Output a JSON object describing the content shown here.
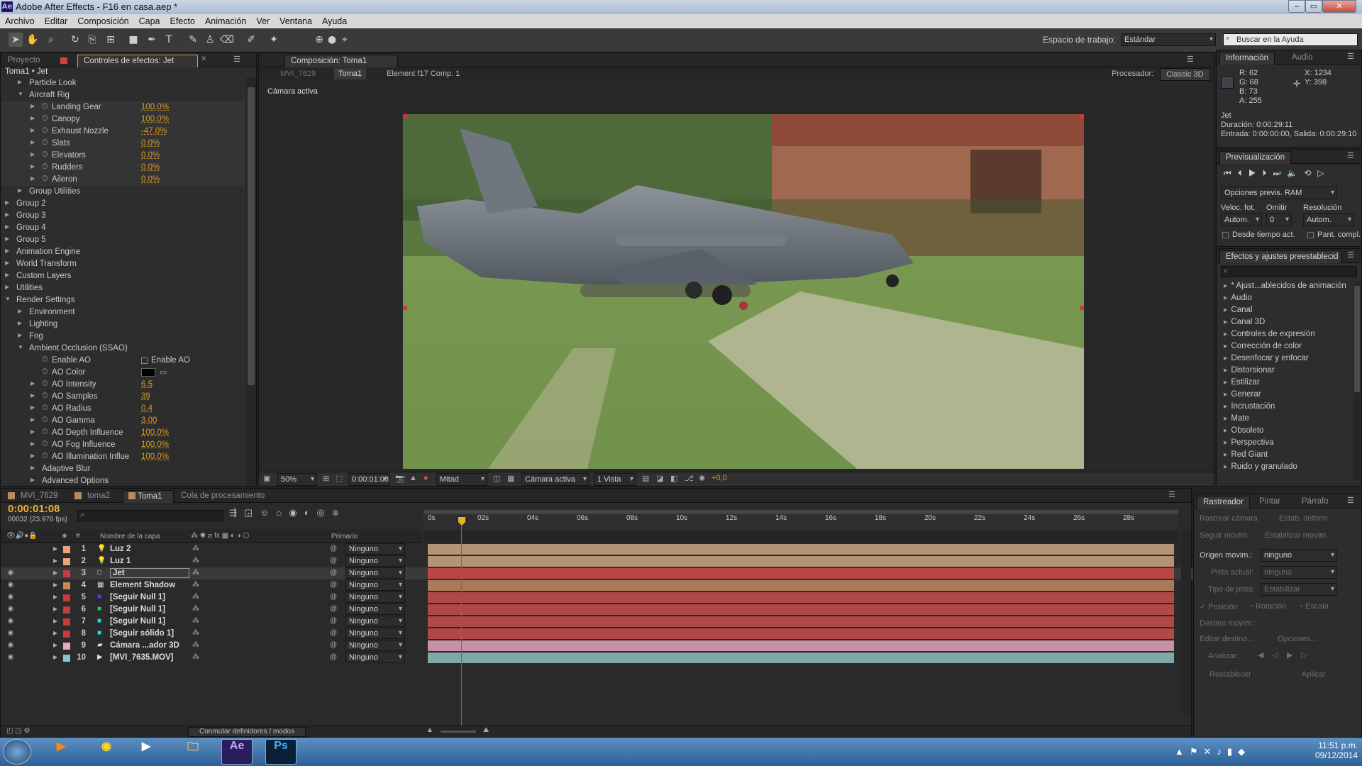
{
  "window": {
    "title": "Adobe After Effects - F16 en casa.aep *"
  },
  "menu": [
    "Archivo",
    "Editar",
    "Composición",
    "Capa",
    "Efecto",
    "Animación",
    "Ver",
    "Ventana",
    "Ayuda"
  ],
  "toolbar": {
    "workspace_label": "Espacio de trabajo:",
    "workspace_value": "Estándar",
    "search_placeholder": "Buscar en la Ayuda"
  },
  "left_panel": {
    "tab_project": "Proyecto",
    "tab_effects": "Controles de efectos: Jet",
    "breadcrumb": "Toma1 • Jet",
    "rows": [
      {
        "label": "Particle Look",
        "indent": 2,
        "tri": "closed"
      },
      {
        "label": "Aircraft Rig",
        "indent": 2,
        "tri": "open"
      },
      {
        "label": "Landing Gear",
        "indent": 3,
        "tri": "closed",
        "sw": true,
        "value": "100,0%"
      },
      {
        "label": "Canopy",
        "indent": 3,
        "tri": "closed",
        "sw": true,
        "value": "100,0%"
      },
      {
        "label": "Exhaust Nozzle",
        "indent": 3,
        "tri": "closed",
        "sw": true,
        "value": "-47,0%"
      },
      {
        "label": "Slats",
        "indent": 3,
        "tri": "closed",
        "sw": true,
        "value": "0,0%"
      },
      {
        "label": "Elevators",
        "indent": 3,
        "tri": "closed",
        "sw": true,
        "value": "0,0%"
      },
      {
        "label": "Rudders",
        "indent": 3,
        "tri": "closed",
        "sw": true,
        "value": "0,0%"
      },
      {
        "label": "Aileron",
        "indent": 3,
        "tri": "closed",
        "sw": true,
        "value": "0,0%"
      },
      {
        "label": "Group Utilities",
        "indent": 2,
        "tri": "closed"
      },
      {
        "label": "Group 2",
        "indent": 1,
        "tri": "closed"
      },
      {
        "label": "Group 3",
        "indent": 1,
        "tri": "closed"
      },
      {
        "label": "Group 4",
        "indent": 1,
        "tri": "closed"
      },
      {
        "label": "Group 5",
        "indent": 1,
        "tri": "closed"
      },
      {
        "label": "Animation Engine",
        "indent": 1,
        "tri": "closed"
      },
      {
        "label": "World Transform",
        "indent": 1,
        "tri": "closed"
      },
      {
        "label": "Custom Layers",
        "indent": 1,
        "tri": "closed"
      },
      {
        "label": "Utilities",
        "indent": 1,
        "tri": "closed"
      },
      {
        "label": "Render Settings",
        "indent": 1,
        "tri": "open"
      },
      {
        "label": "Environment",
        "indent": 2,
        "tri": "closed"
      },
      {
        "label": "Lighting",
        "indent": 2,
        "tri": "closed"
      },
      {
        "label": "Fog",
        "indent": 2,
        "tri": "closed"
      },
      {
        "label": "Ambient Occlusion (SSAO)",
        "indent": 2,
        "tri": "open"
      },
      {
        "label": "Enable AO",
        "indent": 3,
        "tri": "none",
        "sw": true,
        "checkbox": "Enable AO"
      },
      {
        "label": "AO Color",
        "indent": 3,
        "tri": "none",
        "sw": true,
        "color": "#000000"
      },
      {
        "label": "AO Intensity",
        "indent": 3,
        "tri": "closed",
        "sw": true,
        "value": "6,5"
      },
      {
        "label": "AO Samples",
        "indent": 3,
        "tri": "closed",
        "sw": true,
        "value": "39"
      },
      {
        "label": "AO Radius",
        "indent": 3,
        "tri": "closed",
        "sw": true,
        "value": "0,4"
      },
      {
        "label": "AO Gamma",
        "indent": 3,
        "tri": "closed",
        "sw": true,
        "value": "3,00"
      },
      {
        "label": "AO Depth Influence",
        "indent": 3,
        "tri": "closed",
        "sw": true,
        "value": "100,0%"
      },
      {
        "label": "AO Fog Influence",
        "indent": 3,
        "tri": "closed",
        "sw": true,
        "value": "100,0%"
      },
      {
        "label": "AO Illumination Influe",
        "indent": 3,
        "tri": "closed",
        "sw": true,
        "value": "100,0%"
      },
      {
        "label": "Adaptive Blur",
        "indent": 3,
        "tri": "closed"
      },
      {
        "label": "Advanced Options",
        "indent": 3,
        "tri": "closed"
      }
    ]
  },
  "comp": {
    "tab": "Composición: Toma1",
    "crumb1": "MVI_7629",
    "crumb2": "Toma1",
    "crumb3": "Element f17 Comp. 1",
    "renderer_label": "Procesador:",
    "renderer": "Classic 3D",
    "active_camera": "Cámara activa",
    "footer": {
      "zoom": "50%",
      "time": "0:00:01:08",
      "resolution": "Mitad",
      "camera": "Cámara activa",
      "views": "1 Vista",
      "exposure": "+0,0"
    }
  },
  "info": {
    "tab": "Información",
    "tab2": "Audio",
    "r": "R: 62",
    "g": "G: 68",
    "b": "B: 73",
    "a": "A: 255",
    "x": "X: 1234",
    "y": "Y: 398",
    "layer": "Jet",
    "duration": "Duración: 0:00:29:11",
    "inout": "Entrada: 0:00:00:00, Salida: 0:00:29:10"
  },
  "preview": {
    "tab": "Previsualización",
    "ram_options": "Opciones previs. RAM",
    "fps_label": "Veloc. fot.",
    "skip_label": "Omitir",
    "res_label": "Resolución",
    "fps": "Autom.",
    "skip": "0",
    "res": "Autom.",
    "from_current": "Desde tiempo act.",
    "fullscreen": "Pant. compl."
  },
  "effects_presets": {
    "tab": "Efectos y ajustes preestablecid",
    "items": [
      "* Ajust...ablecidos de animación",
      "Audio",
      "Canal",
      "Canal 3D",
      "Controles de expresión",
      "Corrección de color",
      "Desenfocar y enfocar",
      "Distorsionar",
      "Estilizar",
      "Generar",
      "Incrustación",
      "Mate",
      "Obsoleto",
      "Perspectiva",
      "Red Giant",
      "Ruido y granulado"
    ]
  },
  "timeline": {
    "tabs": [
      "MVI_7629",
      "toma2",
      "Toma1",
      "Cola de procesamiento"
    ],
    "current_time": "0:00:01:08",
    "frame_info": "00032 (23.976 fps)",
    "col_name": "Nombre de la capa",
    "col_parent": "Primario",
    "toggle_label": "Conmutar definidores / modos",
    "ruler": [
      "0s",
      "02s",
      "04s",
      "06s",
      "08s",
      "10s",
      "12s",
      "14s",
      "16s",
      "18s",
      "20s",
      "22s",
      "24s",
      "26s",
      "28s"
    ],
    "layers": [
      {
        "num": "1",
        "name": "Luz 2",
        "label": "#e8a47a",
        "icon": "💡",
        "parent": "Ninguno",
        "bar": "#b59474"
      },
      {
        "num": "2",
        "name": "Luz 1",
        "label": "#e8a47a",
        "icon": "💡",
        "parent": "Ninguno",
        "bar": "#b59474"
      },
      {
        "num": "3",
        "name": "Jet",
        "label": "#c53c3c",
        "icon": "□",
        "parent": "Ninguno",
        "bar": "#b84646",
        "selected": true
      },
      {
        "num": "4",
        "name": "Element Shadow",
        "label": "#c58a5a",
        "icon": "▦",
        "parent": "Ninguno",
        "bar": "#a87a5a"
      },
      {
        "num": "5",
        "name": "[Seguir Null 1]",
        "label": "#c53c3c",
        "icon": "■",
        "iconColor": "#4b3dff",
        "parent": "Ninguno",
        "bar": "#b04848"
      },
      {
        "num": "6",
        "name": "[Seguir Null 1]",
        "label": "#c53c3c",
        "icon": "■",
        "iconColor": "#22cc44",
        "parent": "Ninguno",
        "bar": "#b04848"
      },
      {
        "num": "7",
        "name": "[Seguir Null 1]",
        "label": "#c53c3c",
        "icon": "■",
        "iconColor": "#22dddd",
        "parent": "Ninguno",
        "bar": "#b04848"
      },
      {
        "num": "8",
        "name": "[Seguir sólido 1]",
        "label": "#c53c3c",
        "icon": "■",
        "iconColor": "#22dddd",
        "parent": "Ninguno",
        "bar": "#b04848"
      },
      {
        "num": "9",
        "name": "Cámara ...ador 3D",
        "label": "#e8a7c0",
        "icon": "▰",
        "parent": "Ninguno",
        "bar": "#c890a4"
      },
      {
        "num": "10",
        "name": "[MVI_7635.MOV]",
        "label": "#8fc4c4",
        "icon": "▶",
        "parent": "Ninguno",
        "bar": "#7fa8a8"
      }
    ]
  },
  "tracker": {
    "tabs": [
      "Rastreador",
      "Pintar",
      "Párrafo"
    ],
    "track_camera": "Rastrear cámara",
    "warp_stab": "Estab. deform.",
    "track_motion": "Seguir movim.",
    "stabilize": "Estabilizar movim.",
    "source_label": "Origen movim.:",
    "source": "ninguno",
    "current_track": "Pista actual:",
    "current_track_val": "ninguno",
    "track_type": "Tipo de pista:",
    "track_type_val": "Estabilizar",
    "position": "Posición",
    "rotation": "Rotación",
    "scale": "Escala",
    "target": "Destino movim.:",
    "edit_target": "Editar destino...",
    "options": "Opciones...",
    "analyze": "Analizar:",
    "reset": "Restablecer",
    "apply": "Aplicar"
  },
  "taskbar": {
    "time": "11:51 p.m.",
    "date": "09/12/2014",
    "apps": [
      "Ae",
      "Ps"
    ]
  }
}
